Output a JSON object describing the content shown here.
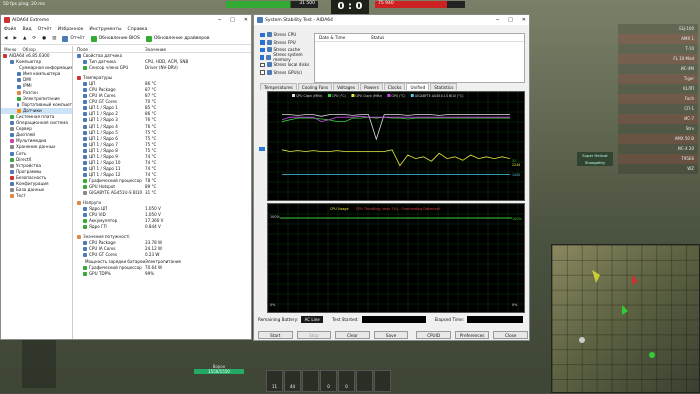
{
  "game": {
    "fps_text": "50 fps   ping: 20 ms",
    "hp_left": "31 500",
    "hp_right": "75 940",
    "score_left": "0",
    "score_sep": ":",
    "score_right": "0",
    "team_list": [
      "ЕЦ-100",
      "AMX 1",
      "T-10",
      "FL 10 Mod",
      "ИС-4М",
      "Tiger",
      "KLЛП",
      "Foch",
      "СП-1",
      "ИС-7",
      "Strv",
      "AMX 50 B",
      "ИС-4 20",
      "T95E6",
      "WZ"
    ],
    "damage_tag": [
      "Super Hellcat",
      "Shoogethy"
    ],
    "ammo_counts": [
      "11",
      "44",
      "",
      "0",
      "0",
      "",
      ""
    ],
    "tank_name": "Ворон",
    "tank_hp": "1550/1550"
  },
  "aida": {
    "title": "AIDA64 Extreme",
    "menu": [
      "Файл",
      "Вид",
      "Отчёт",
      "Избранное",
      "Инструменты",
      "Справка"
    ],
    "toolbar": {
      "report_label": "Отчёт",
      "bios_label": "Обновление BIOS",
      "driver_label": "Обновление драйверов"
    },
    "tree_tabs": [
      "Меню",
      "Обзор"
    ],
    "tree": [
      {
        "label": "AIDA64 v6.85.6300",
        "level": 0,
        "color": "#c33"
      },
      {
        "label": "Компьютер",
        "level": 1,
        "color": "#4a7ab8"
      },
      {
        "label": "Суммарная информация",
        "level": 2,
        "color": "#4a7ab8"
      },
      {
        "label": "Имя компьютера",
        "level": 2,
        "color": "#4a7ab8"
      },
      {
        "label": "DMI",
        "level": 2,
        "color": "#4a7ab8"
      },
      {
        "label": "IPMI",
        "level": 2,
        "color": "#4a7ab8"
      },
      {
        "label": "Разгон",
        "level": 2,
        "color": "#d84"
      },
      {
        "label": "Электропитание",
        "level": 2,
        "color": "#3a3"
      },
      {
        "label": "Портативный компьют",
        "level": 2,
        "color": "#4a7ab8"
      },
      {
        "label": "Датчики",
        "level": 2,
        "color": "#f80",
        "selected": true
      },
      {
        "label": "Системная плата",
        "level": 1,
        "color": "#3a3"
      },
      {
        "label": "Операционная система",
        "level": 1,
        "color": "#4a7ab8"
      },
      {
        "label": "Сервер",
        "level": 1,
        "color": "#888"
      },
      {
        "label": "Дисплей",
        "level": 1,
        "color": "#4a7ab8"
      },
      {
        "label": "Мультимедиа",
        "level": 1,
        "color": "#c4a"
      },
      {
        "label": "Хранение данных",
        "level": 1,
        "color": "#888"
      },
      {
        "label": "Сеть",
        "level": 1,
        "color": "#4a7ab8"
      },
      {
        "label": "DirectX",
        "level": 1,
        "color": "#3a3"
      },
      {
        "label": "Устройства",
        "level": 1,
        "color": "#888"
      },
      {
        "label": "Программы",
        "level": 1,
        "color": "#4a7ab8"
      },
      {
        "label": "Безопасность",
        "level": 1,
        "color": "#c33"
      },
      {
        "label": "Конфигурация",
        "level": 1,
        "color": "#4a7ab8"
      },
      {
        "label": "База данных",
        "level": 1,
        "color": "#888"
      },
      {
        "label": "Тест",
        "level": 1,
        "color": "#d84"
      }
    ],
    "detail_head": {
      "field": "Поле",
      "value": "Значение"
    },
    "sections": [
      {
        "title": "Свойства датчика",
        "color": "#4a7ab8",
        "rows": [
          {
            "f": "Тип датчика",
            "v": "CPU, HDD, ACPI, SNB",
            "c": "#4a7ab8"
          },
          {
            "f": "Сенсор члена GPU",
            "v": "Driver (NV-DRV)",
            "c": "#3a3"
          }
        ]
      },
      {
        "title": "Температуры",
        "color": "#c33",
        "rows": [
          {
            "f": "ЦП",
            "v": "86 °C",
            "c": "#4a7ab8"
          },
          {
            "f": "CPU Package",
            "v": "87 °C",
            "c": "#4a7ab8"
          },
          {
            "f": "CPU IA Cores",
            "v": "87 °C",
            "c": "#4a7ab8"
          },
          {
            "f": "CPU GT Cores",
            "v": "70 °C",
            "c": "#4a7ab8"
          },
          {
            "f": "ЦП 1 / Ядро 1",
            "v": "85 °C",
            "c": "#4a7ab8"
          },
          {
            "f": "ЦП 1 / Ядро 2",
            "v": "86 °C",
            "c": "#4a7ab8"
          },
          {
            "f": "ЦП 1 / Ядро 3",
            "v": "76 °C",
            "c": "#4a7ab8"
          },
          {
            "f": "ЦП 1 / Ядро 4",
            "v": "76 °C",
            "c": "#4a7ab8"
          },
          {
            "f": "ЦП 1 / Ядро 5",
            "v": "75 °C",
            "c": "#4a7ab8"
          },
          {
            "f": "ЦП 1 / Ядро 6",
            "v": "75 °C",
            "c": "#4a7ab8"
          },
          {
            "f": "ЦП 1 / Ядро 7",
            "v": "75 °C",
            "c": "#4a7ab8"
          },
          {
            "f": "ЦП 1 / Ядро 8",
            "v": "75 °C",
            "c": "#4a7ab8"
          },
          {
            "f": "ЦП 1 / Ядро 9",
            "v": "74 °C",
            "c": "#4a7ab8"
          },
          {
            "f": "ЦП 1 / Ядро 10",
            "v": "74 °C",
            "c": "#4a7ab8"
          },
          {
            "f": "ЦП 1 / Ядро 11",
            "v": "74 °C",
            "c": "#4a7ab8"
          },
          {
            "f": "ЦП 1 / Ядро 12",
            "v": "74 °C",
            "c": "#4a7ab8"
          },
          {
            "f": "Графический процессор",
            "v": "78 °C",
            "c": "#3a3"
          },
          {
            "f": "GPU Hotspot",
            "v": "89 °C",
            "c": "#3a3"
          },
          {
            "f": "GIGABYTE AG451U-S BI10",
            "v": "31 °C",
            "c": "#888"
          }
        ]
      },
      {
        "title": "Напруги",
        "color": "#d84",
        "rows": [
          {
            "f": "Ядро ЦП",
            "v": "1.050 V",
            "c": "#4a7ab8"
          },
          {
            "f": "CPU VID",
            "v": "1.050 V",
            "c": "#4a7ab8"
          },
          {
            "f": "Аккумулятор",
            "v": "17.360 V",
            "c": "#3a3"
          },
          {
            "f": "Ядро ГП",
            "v": "0.844 V",
            "c": "#3a3"
          }
        ]
      },
      {
        "title": "Значения потужності",
        "color": "#d84",
        "rows": [
          {
            "f": "CPU Package",
            "v": "33.78 W",
            "c": "#4a7ab8"
          },
          {
            "f": "CPU IA Cores",
            "v": "24.12 W",
            "c": "#4a7ab8"
          },
          {
            "f": "CPU GT Cores",
            "v": "0.23 W",
            "c": "#4a7ab8"
          },
          {
            "f": "Мощность зарядки батареи",
            "v": "Электропитание",
            "c": "#3a3"
          },
          {
            "f": "Графический процессор",
            "v": "70.64 W",
            "c": "#3a3"
          },
          {
            "f": "GPU TDP%",
            "v": "99%",
            "c": "#3a3"
          }
        ]
      }
    ]
  },
  "sst": {
    "title": "System Stability Test - AIDA64",
    "stress": [
      {
        "label": "Stress CPU",
        "on": true
      },
      {
        "label": "Stress FPU",
        "on": true
      },
      {
        "label": "Stress cache",
        "on": true
      },
      {
        "label": "Stress system memory",
        "on": true
      },
      {
        "label": "Stress local disks",
        "on": false
      },
      {
        "label": "Stress GPU(s)",
        "on": false
      }
    ],
    "status_head": {
      "date": "Date & Time",
      "status": "Status"
    },
    "tabs": [
      "Temperatures",
      "Cooling Fans",
      "Voltages",
      "Powers",
      "Clocks",
      "Unified",
      "Statistics"
    ],
    "active_tab": "Unified",
    "legend1": [
      "CPU Clock (MHz)",
      "CPU (°C)",
      "GPU Clock (MHz)",
      "GPU (°C)",
      "GIGABYTE AG451U-S BI10 (°C)"
    ],
    "legend1_colors": [
      "#e0e0e0",
      "#3cd03c",
      "#e8e83c",
      "#c64ce8",
      "#4ccce8"
    ],
    "graph1_right_labels": [
      "31",
      "2244",
      "1420"
    ],
    "graph2_title": "CPU Usage",
    "graph2_title_warn": "CPU Throttling (max 7%) - Overheating Detected!",
    "graph2_y": [
      "100%",
      "0%"
    ],
    "graph2_right": [
      "100%",
      "0%"
    ],
    "bottom": {
      "battery_label": "Remaining Battery:",
      "battery_value": "AC Line",
      "started_label": "Test Started:",
      "elapsed_label": "Elapsed Time:"
    },
    "buttons": [
      {
        "label": "Start",
        "disabled": false
      },
      {
        "label": "Stop",
        "disabled": true
      },
      {
        "label": "Clear",
        "disabled": false
      },
      {
        "label": "Save",
        "disabled": false
      },
      {
        "label": "CPUID",
        "disabled": false
      },
      {
        "label": "Preferences",
        "disabled": false
      },
      {
        "label": "Close",
        "disabled": false
      }
    ]
  },
  "chart_data": [
    {
      "type": "line",
      "title": "",
      "series": [
        {
          "name": "CPU Clock (MHz)",
          "values": [
            88,
            88,
            87,
            88,
            88,
            86,
            88,
            88,
            88,
            87,
            88,
            88,
            60,
            88,
            88,
            88,
            87,
            88,
            88,
            88,
            87,
            88,
            88,
            88,
            88,
            88,
            88,
            88,
            88,
            88
          ]
        },
        {
          "name": "CPU (°C)",
          "values": [
            80,
            82,
            84,
            84,
            84,
            83,
            82,
            80,
            80,
            84,
            84,
            85,
            84,
            85,
            84,
            84,
            83,
            84,
            84,
            84,
            84,
            84,
            84,
            84,
            84,
            84,
            84,
            84,
            84,
            84
          ]
        },
        {
          "name": "GPU Clock (MHz)",
          "values": [
            48,
            46,
            47,
            46,
            47,
            46,
            46,
            47,
            46,
            46,
            46,
            46,
            46,
            46,
            48,
            30,
            42,
            38,
            40,
            35,
            44,
            38,
            40,
            36,
            42,
            38,
            40,
            38,
            40,
            38
          ]
        },
        {
          "name": "GPU (°C)",
          "values": [
            82,
            85,
            85,
            85,
            85,
            80,
            82,
            85,
            85,
            85,
            86,
            85,
            85,
            85,
            85,
            85,
            85,
            85,
            85,
            85,
            85,
            85,
            85,
            85,
            85,
            85,
            85,
            85,
            85,
            85
          ]
        },
        {
          "name": "GIGABYTE AG451U-S BI10 (°C)",
          "values": [
            20,
            20,
            20,
            20,
            20,
            20,
            20,
            20,
            20,
            20,
            20,
            20,
            20,
            20,
            20,
            20,
            20,
            20,
            20,
            20,
            20,
            20,
            20,
            20,
            20,
            20,
            20,
            20,
            20,
            20
          ]
        }
      ]
    },
    {
      "type": "line",
      "title": "CPU Usage",
      "series": [
        {
          "name": "CPU Usage",
          "values": [
            100,
            100,
            100,
            100,
            100,
            100,
            100,
            100,
            100,
            100,
            100,
            100,
            100,
            100,
            100,
            100,
            100,
            100,
            100,
            100,
            100,
            100,
            100,
            100,
            100,
            100,
            100,
            100,
            100,
            100
          ]
        }
      ],
      "ylim": [
        0,
        100
      ]
    }
  ]
}
